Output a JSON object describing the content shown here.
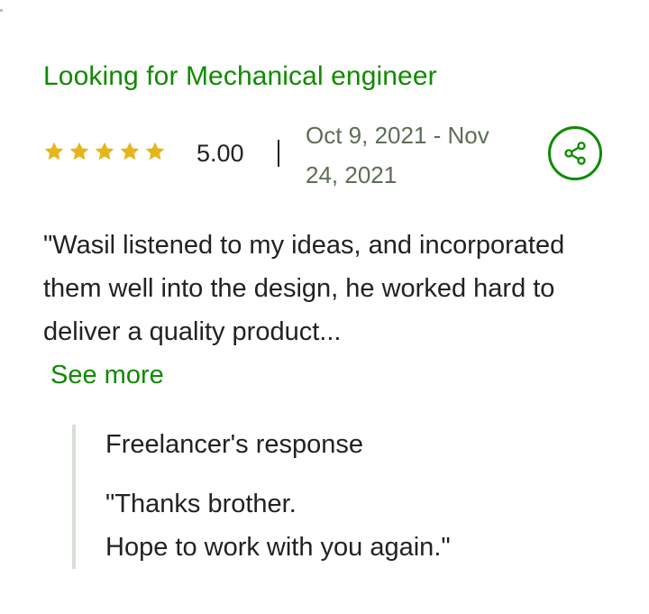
{
  "review": {
    "title": "Looking for Mechanical engineer",
    "rating": {
      "stars": 5,
      "max_stars": 5,
      "value_text": "5.00",
      "star_color": "#e6b51b"
    },
    "dates": "Oct 9, 2021 - Nov 24, 2021",
    "share_icon": "share-icon",
    "text": "\"Wasil listened to my ideas, and incorporated them well into the design, he worked hard to deliver a quality product...",
    "see_more_label": "See more"
  },
  "response": {
    "title": "Freelancer's response",
    "text": "\"Thanks brother.\nHope to work with you again.\""
  },
  "colors": {
    "accent": "#108a00",
    "text": "#222222",
    "muted": "#5e6d55"
  }
}
